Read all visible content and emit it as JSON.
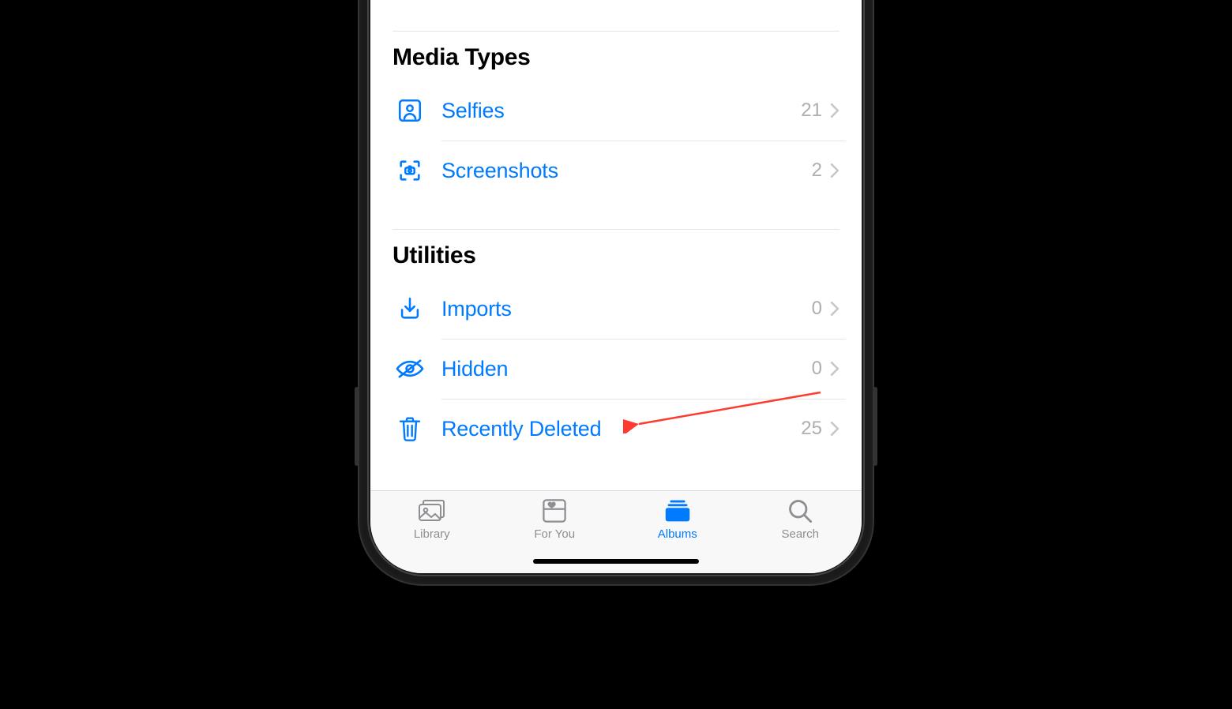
{
  "sections": {
    "media_types": {
      "header": "Media Types",
      "rows": [
        {
          "label": "Selfies",
          "count": "21"
        },
        {
          "label": "Screenshots",
          "count": "2"
        }
      ]
    },
    "utilities": {
      "header": "Utilities",
      "rows": [
        {
          "label": "Imports",
          "count": "0"
        },
        {
          "label": "Hidden",
          "count": "0"
        },
        {
          "label": "Recently Deleted",
          "count": "25"
        }
      ]
    }
  },
  "tabs": {
    "library": "Library",
    "for_you": "For You",
    "albums": "Albums",
    "search": "Search"
  },
  "colors": {
    "link": "#007AFF",
    "muted": "#8e8e93",
    "chevron": "#c7c7cc",
    "annotation": "#ff3b30"
  }
}
